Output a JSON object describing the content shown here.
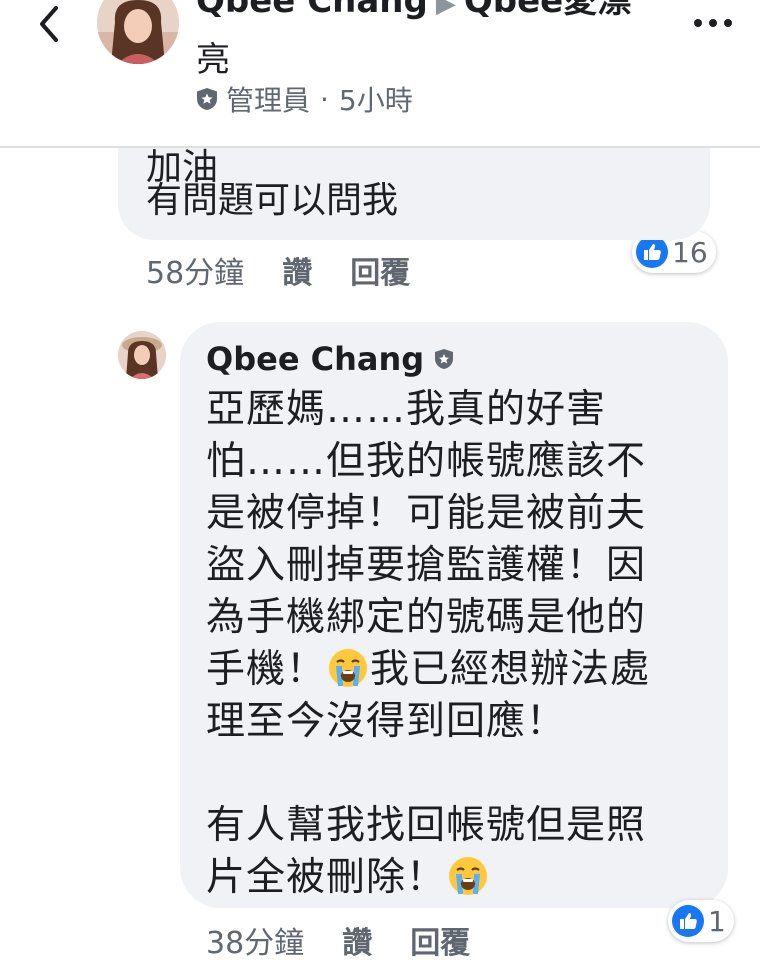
{
  "header": {
    "author": "Qbee Chang",
    "separator": "▶",
    "group_line1": "Qbee愛漂",
    "group_line2": "亮",
    "role": "管理員",
    "dot": "·",
    "time": "5小時"
  },
  "comment1": {
    "text_cut": "加油",
    "text": "有問題可以問我",
    "time": "58分鐘",
    "like": "讚",
    "reply": "回覆",
    "reaction_count": "16"
  },
  "comment2": {
    "author": "Qbee Chang",
    "lines": [
      "亞歷媽……我真的好害",
      "怕……但我的帳號應該不",
      "是被停掉！可能是被前夫",
      "盜入刪掉要搶監護權！因",
      "為手機綁定的號碼是他的",
      "手機！",
      "我已經想辦法處",
      "理至今沒得到回應！",
      "有人幫我找回帳號但是照",
      "片全被刪除！"
    ],
    "time": "38分鐘",
    "like": "讚",
    "reply": "回覆",
    "reaction_count": "1"
  },
  "colors": {
    "bubble": "#f0f2f5",
    "meta": "#606770",
    "like_blue": "#1877f2"
  },
  "icons": {
    "back": "chevron-left-icon",
    "more": "more-horizontal-icon",
    "admin": "shield-icon",
    "like": "like-thumb-icon",
    "emoji": "crying-face-emoji"
  }
}
